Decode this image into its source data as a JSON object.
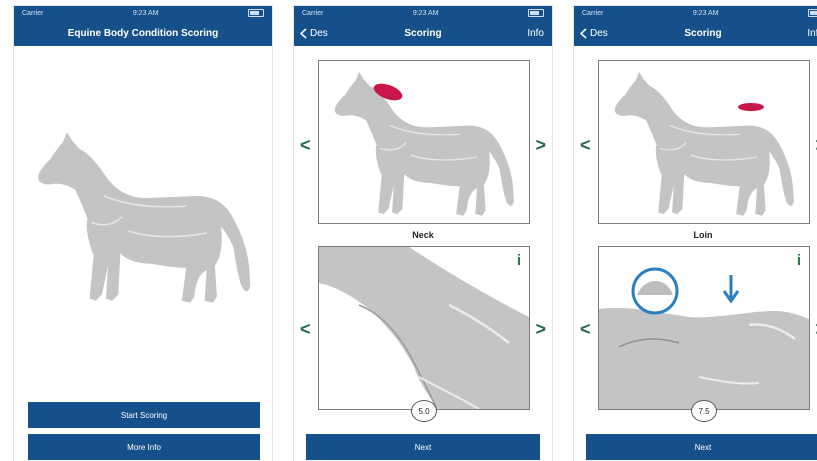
{
  "screens": [
    {
      "status": {
        "carrier": "Carrier",
        "time": "9:23 AM"
      },
      "title": "Equine Body Condition Scoring",
      "buttons": {
        "start": "Start Scoring",
        "more": "More Info"
      }
    },
    {
      "status": {
        "carrier": "Carrier",
        "time": "9:23 AM"
      },
      "back_label": "Des",
      "title": "Scoring",
      "right_label": "Info",
      "region_label": "Neck",
      "score_value": "5.0",
      "info_label": "i",
      "prev_symbol": "<",
      "next_symbol": ">",
      "next_button": "Next"
    },
    {
      "status": {
        "carrier": "Carrier",
        "time": "9:23 AM"
      },
      "back_label": "Des",
      "title": "Scoring",
      "right_label": "Info",
      "region_label": "Loin",
      "score_value": "7.5",
      "info_label": "i",
      "prev_symbol": "<",
      "next_symbol": ">",
      "next_button": "Next"
    }
  ],
  "colors": {
    "nav": "#16508a",
    "arrow": "#1f6b4a",
    "highlight": "#c8184a",
    "horse": "#c4c4c4"
  }
}
